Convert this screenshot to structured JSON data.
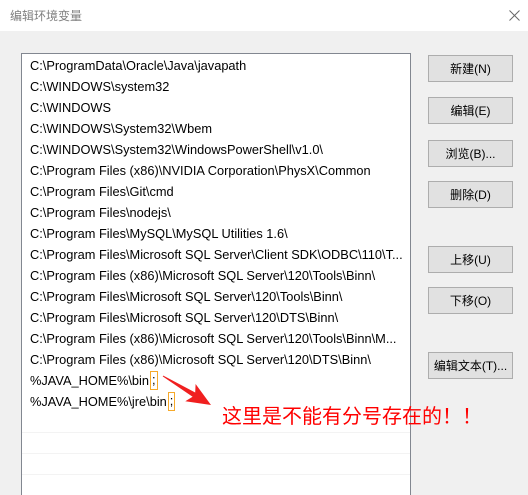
{
  "window": {
    "title": "编辑环境变量"
  },
  "icons": {
    "close": "close-icon",
    "arrow": "red-arrow"
  },
  "list": {
    "items": [
      {
        "text": "C:\\ProgramData\\Oracle\\Java\\javapath"
      },
      {
        "text": "C:\\WINDOWS\\system32"
      },
      {
        "text": "C:\\WINDOWS"
      },
      {
        "text": "C:\\WINDOWS\\System32\\Wbem"
      },
      {
        "text": "C:\\WINDOWS\\System32\\WindowsPowerShell\\v1.0\\"
      },
      {
        "text": "C:\\Program Files (x86)\\NVIDIA Corporation\\PhysX\\Common"
      },
      {
        "text": "C:\\Program Files\\Git\\cmd"
      },
      {
        "text": "C:\\Program Files\\nodejs\\"
      },
      {
        "text": "C:\\Program Files\\MySQL\\MySQL Utilities 1.6\\"
      },
      {
        "text": "C:\\Program Files\\Microsoft SQL Server\\Client SDK\\ODBC\\110\\T..."
      },
      {
        "text": "C:\\Program Files (x86)\\Microsoft SQL Server\\120\\Tools\\Binn\\"
      },
      {
        "text": "C:\\Program Files\\Microsoft SQL Server\\120\\Tools\\Binn\\"
      },
      {
        "text": "C:\\Program Files\\Microsoft SQL Server\\120\\DTS\\Binn\\"
      },
      {
        "text": "C:\\Program Files (x86)\\Microsoft SQL Server\\120\\Tools\\Binn\\M..."
      },
      {
        "text": "C:\\Program Files (x86)\\Microsoft SQL Server\\120\\DTS\\Binn\\"
      },
      {
        "text": "%JAVA_HOME%\\bin",
        "highlight": ";"
      },
      {
        "text": "%JAVA_HOME%\\jre\\bin",
        "highlight": ";"
      }
    ]
  },
  "buttons": {
    "new": "新建(N)",
    "edit": "编辑(E)",
    "browse": "浏览(B)...",
    "delete": "删除(D)",
    "move_up": "上移(U)",
    "move_down": "下移(O)",
    "edit_text": "编辑文本(T)..."
  },
  "annotation": {
    "text": "这里是不能有分号存在的！！"
  },
  "colors": {
    "annotation": "#ff0000",
    "highlight_box": "#f6a92a",
    "button_bg": "#e1e1e1",
    "button_border": "#adadad",
    "list_border": "#828790"
  }
}
